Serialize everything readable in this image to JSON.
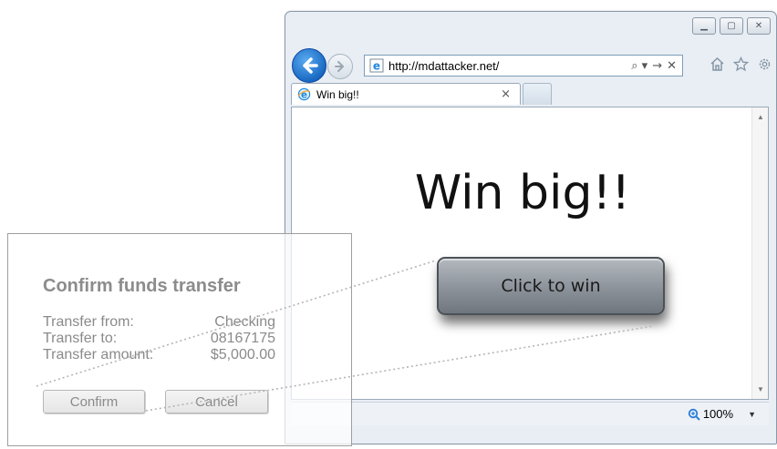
{
  "browser": {
    "window_controls": [
      "minimize",
      "maximize",
      "close"
    ],
    "address": {
      "url": "http://mdattacker.net/",
      "action_glyphs": [
        "⌕ ▾",
        "→",
        "✕"
      ]
    },
    "tab": {
      "title": "Win big!!",
      "close_glyph": "×"
    },
    "page": {
      "heading": "Win big!!",
      "button_label": "Click to win"
    },
    "status": {
      "zoom": "100%",
      "zoom_arrow": "▼"
    }
  },
  "hidden_dialog": {
    "title": "Confirm funds transfer",
    "fields": [
      {
        "label": "Transfer from:",
        "value": "Checking"
      },
      {
        "label": "Transfer to:",
        "value": "08167175"
      },
      {
        "label": "Transfer amount:",
        "value": "$5,000.00"
      }
    ],
    "confirm_label": "Confirm",
    "cancel_label": "Cancel"
  },
  "colors": {
    "back_button": "#1565c0",
    "win_button": "#8c929a",
    "dialog_text": "#8a8a8a"
  }
}
